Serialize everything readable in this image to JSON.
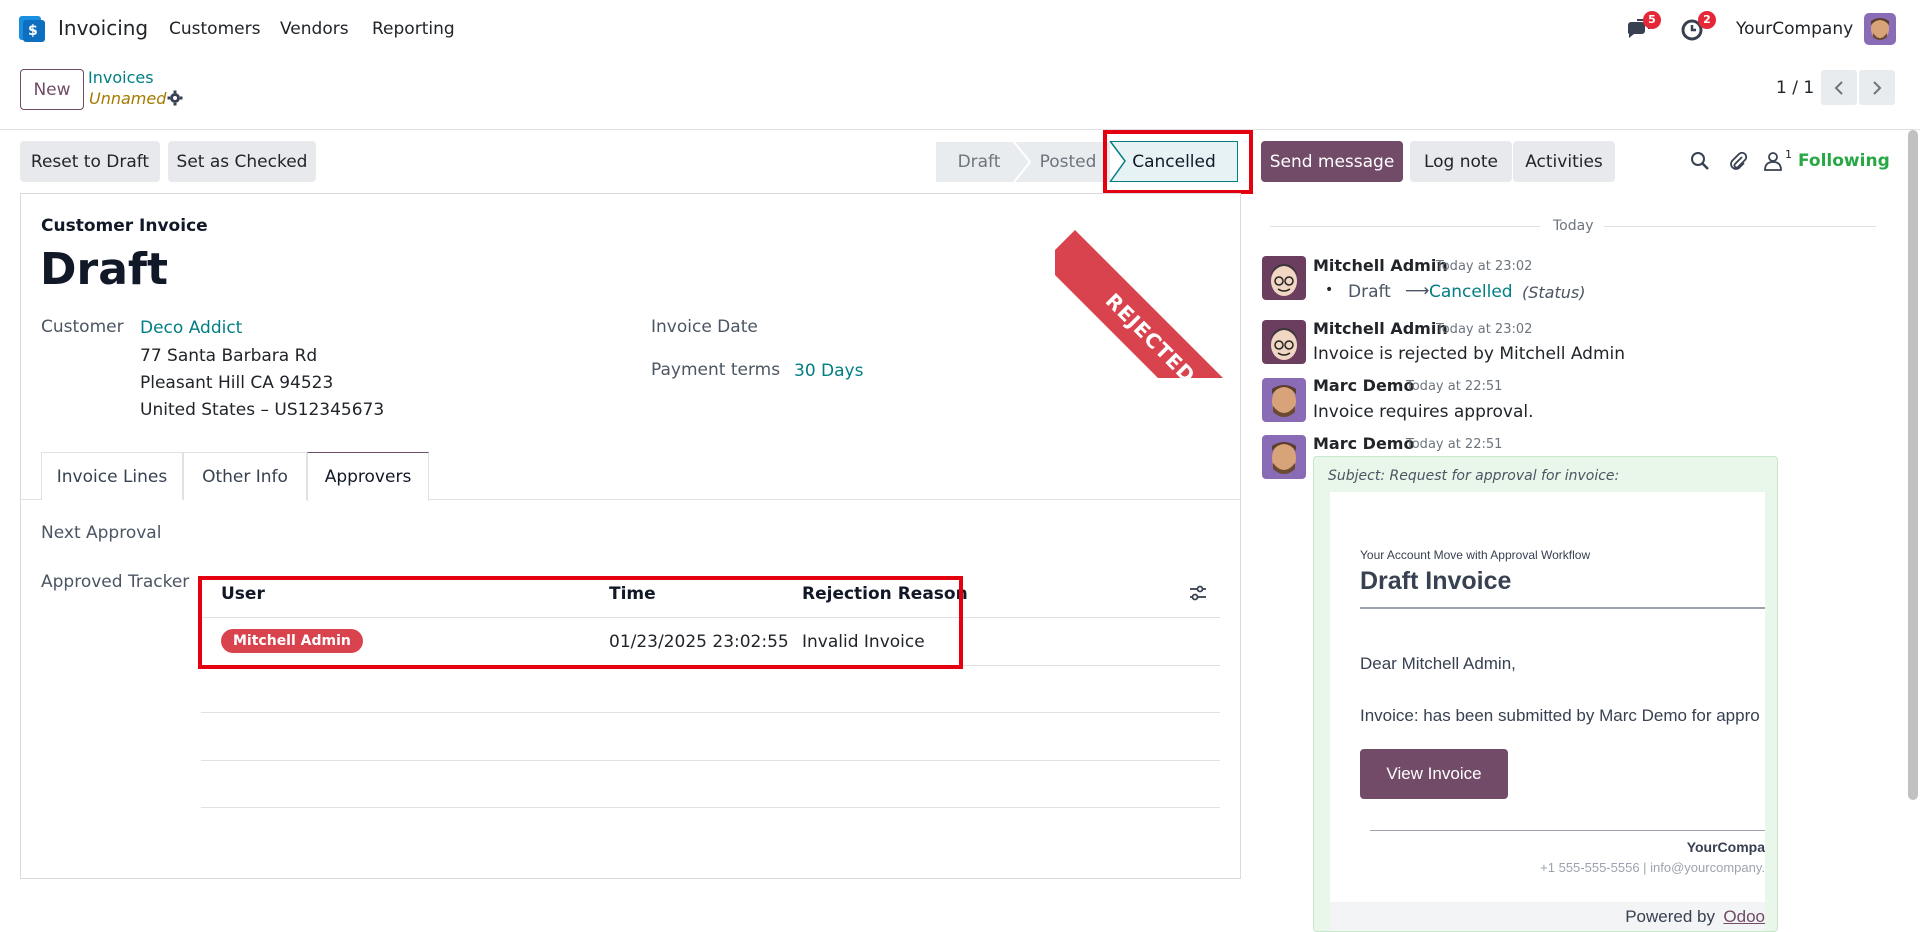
{
  "navbar": {
    "app_name": "Invoicing",
    "menu": [
      "Customers",
      "Vendors",
      "Reporting"
    ],
    "messages_badge": "5",
    "activities_badge": "2",
    "company": "YourCompany"
  },
  "control_panel": {
    "new_label": "New",
    "breadcrumb_parent": "Invoices",
    "breadcrumb_current": "Unnamed",
    "pager": "1 / 1"
  },
  "status_bar": {
    "reset_label": "Reset to Draft",
    "checked_label": "Set as Checked",
    "stages": [
      "Draft",
      "Posted",
      "Cancelled"
    ],
    "active_stage": "Cancelled"
  },
  "form": {
    "ribbon": "REJECTED",
    "doc_type": "Customer Invoice",
    "title": "Draft",
    "customer_label": "Customer",
    "customer_name": "Deco Addict",
    "address_line1": "77 Santa Barbara Rd",
    "address_line2": "Pleasant Hill CA 94523",
    "address_line3": "United States – US12345673",
    "invoice_date_label": "Invoice Date",
    "payment_terms_label": "Payment terms",
    "payment_terms_value": "30 Days",
    "tabs": [
      "Invoice Lines",
      "Other Info",
      "Approvers"
    ],
    "active_tab": "Approvers",
    "next_approval_label": "Next Approval",
    "approved_tracker_label": "Approved Tracker",
    "table": {
      "columns": [
        "User",
        "Time",
        "Rejection Reason"
      ],
      "rows": [
        {
          "user": "Mitchell Admin",
          "time": "01/23/2025 23:02:55",
          "reason": "Invalid Invoice"
        }
      ]
    }
  },
  "chatter": {
    "send_message": "Send message",
    "log_note": "Log note",
    "activities": "Activities",
    "follower_count": "1",
    "following": "Following",
    "today": "Today",
    "messages": [
      {
        "author": "Mitchell Admin",
        "date": "Today at 23:02",
        "from": "Draft",
        "to": "Cancelled",
        "field": "(Status)"
      },
      {
        "author": "Mitchell Admin",
        "date": "Today at 23:02",
        "text": "Invoice is rejected by Mitchell Admin"
      },
      {
        "author": "Marc Demo",
        "date": "Today at 22:51",
        "text": "Invoice requires approval."
      },
      {
        "author": "Marc Demo",
        "date": "Today at 22:51",
        "subject": "Subject: Request for approval for invoice:"
      }
    ],
    "mail": {
      "header_small": "Your Account Move with Approval Workflow",
      "header_title": "Draft Invoice",
      "greeting": "Dear Mitchell Admin,",
      "body": "Invoice: has been submitted by Marc Demo for appro",
      "button": "View Invoice",
      "company": "YourCompa",
      "contact": "+1 555-555-5556 | info@yourcompany.",
      "powered_by": "Powered by",
      "powered_link": "Odoo"
    }
  }
}
